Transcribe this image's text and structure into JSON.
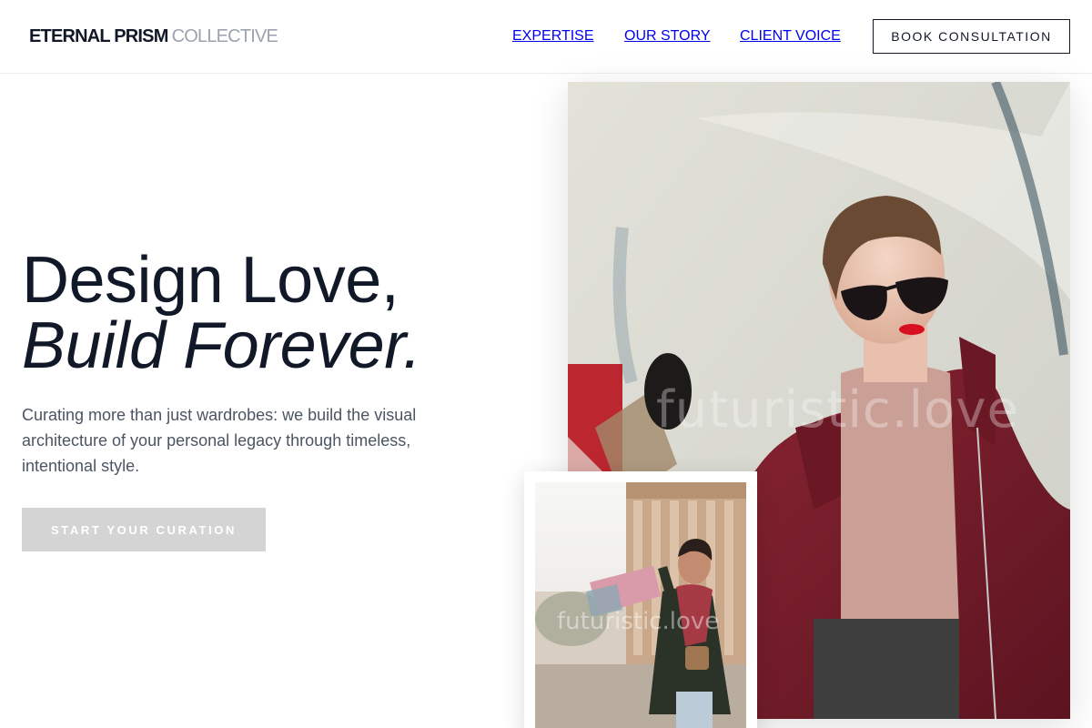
{
  "header": {
    "logo_main": "ETERNAL PRISM",
    "logo_sub": "COLLECTIVE",
    "nav": [
      {
        "label": "EXPERTISE"
      },
      {
        "label": "OUR STORY"
      },
      {
        "label": "CLIENT VOICE"
      }
    ],
    "cta_label": "BOOK CONSULTATION"
  },
  "hero": {
    "title_line1": "Design Love,",
    "title_line2": "Build Forever.",
    "description": "Curating more than just wardrobes: we build the visual architecture of your personal legacy through timeless, intentional style.",
    "cta_label": "START YOUR CURATION"
  },
  "images": {
    "main_watermark": "futuristic.love",
    "card_watermark": "futuristic.love"
  },
  "colors": {
    "text_dark": "#111827",
    "text_muted": "#4b5563",
    "logo_muted": "#9ca3af",
    "button_bg": "#d4d4d4",
    "coat": "#7a1e2c"
  }
}
